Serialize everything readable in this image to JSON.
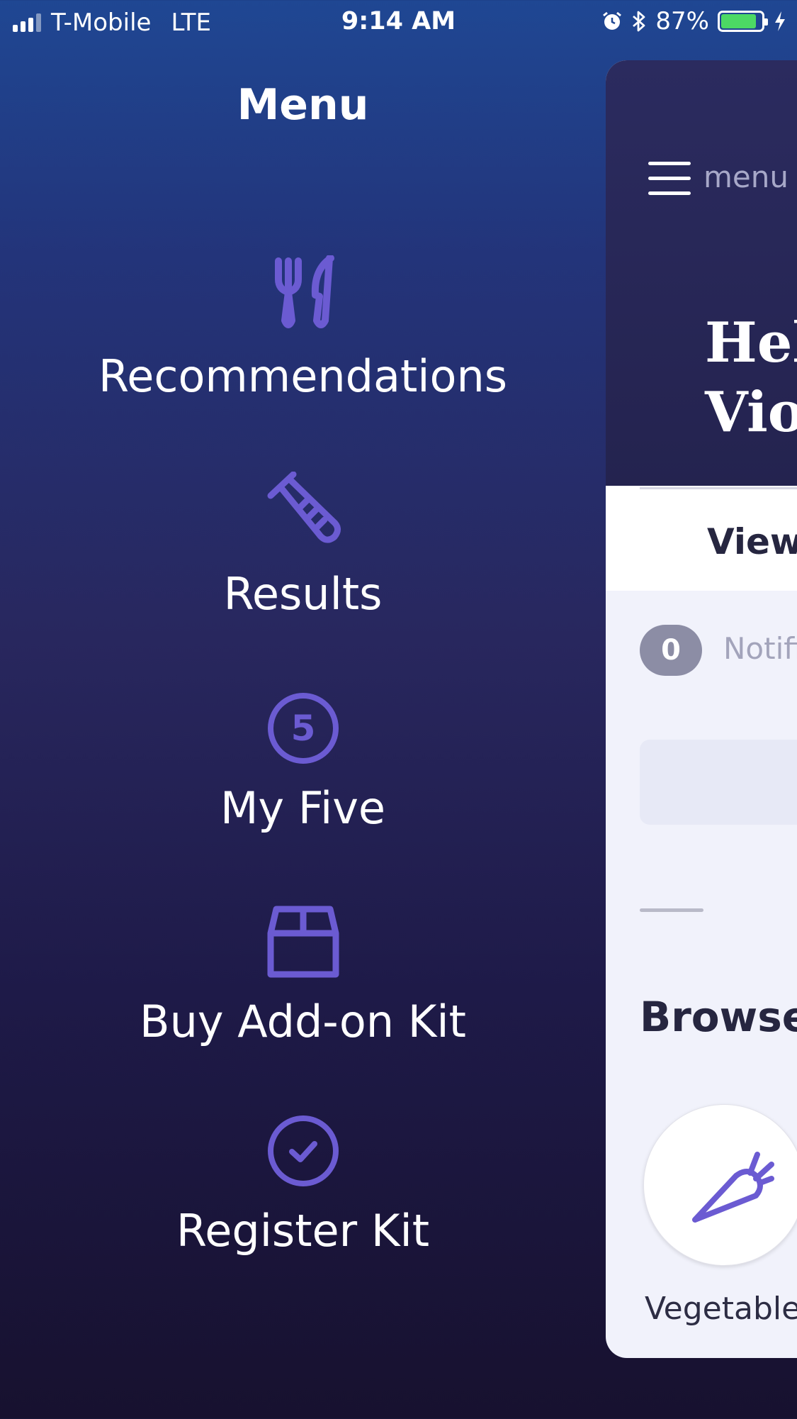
{
  "status_bar": {
    "carrier": "T-Mobile",
    "network": "LTE",
    "time": "9:14 AM",
    "battery_percent": "87%",
    "battery_level": 0.87,
    "icons": [
      "signal-icon",
      "alarm-icon",
      "bluetooth-icon",
      "battery-icon",
      "charging-icon"
    ]
  },
  "menu": {
    "title": "Menu",
    "accent_color": "#6b5bd2",
    "items": [
      {
        "label": "Recommendations",
        "icon": "fork-knife-icon"
      },
      {
        "label": "Results",
        "icon": "test-tube-icon"
      },
      {
        "label": "My Five",
        "icon": "five-circle-icon",
        "icon_text": "5"
      },
      {
        "label": "Buy Add-on Kit",
        "icon": "box-icon"
      },
      {
        "label": "Register Kit",
        "icon": "check-circle-icon"
      }
    ]
  },
  "main_card": {
    "menu_label": "menu",
    "greeting_line1": "Hell",
    "greeting_line2": "Viol",
    "tab_label": "View",
    "notifications_count": "0",
    "notifications_label": "Notifi",
    "browse_title": "Browse",
    "categories": [
      {
        "label": "Vegetables",
        "icon": "carrot-icon"
      }
    ]
  }
}
